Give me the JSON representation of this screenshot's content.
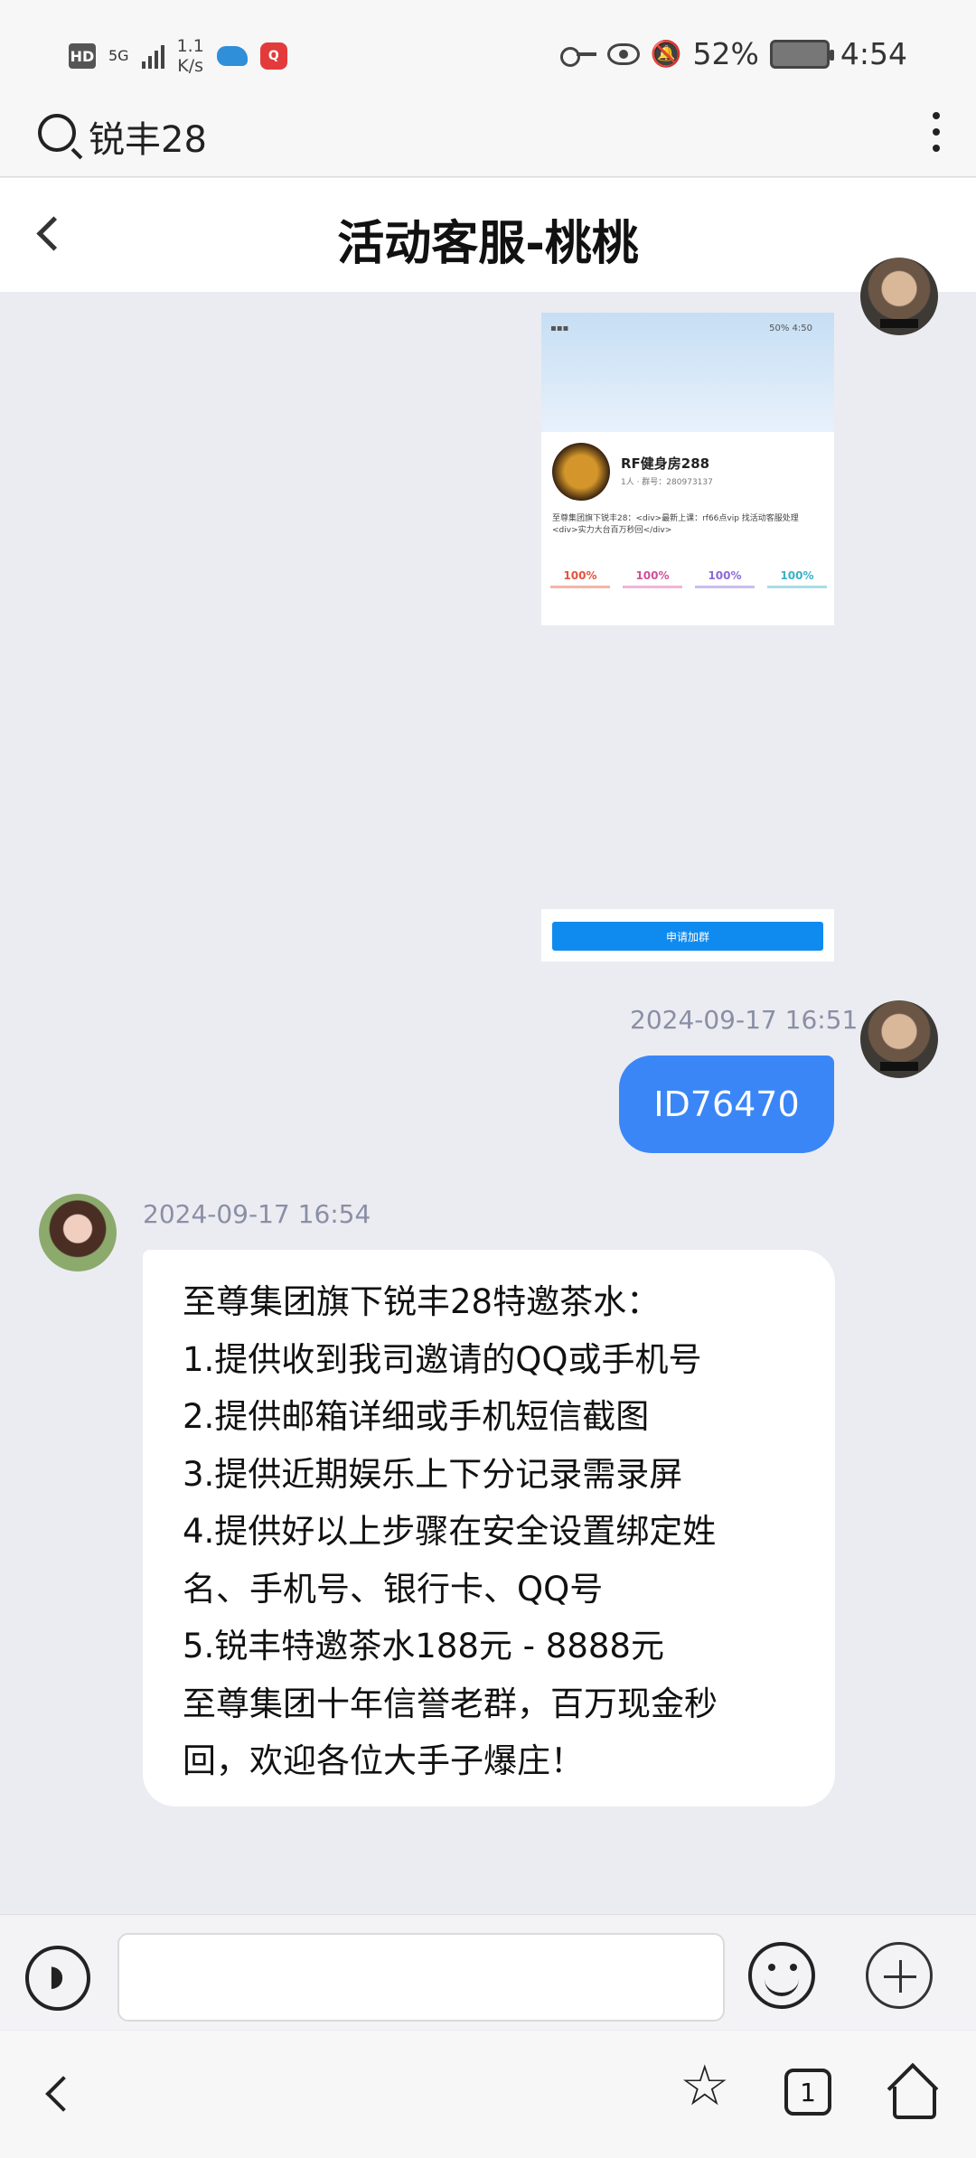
{
  "status_bar": {
    "network": "5G",
    "speed": "1.1\nK/s",
    "battery": "52%",
    "time": "4:54"
  },
  "search": {
    "query": "锐丰28"
  },
  "header": {
    "title": "活动客服-桃桃"
  },
  "messages": {
    "screenshot": {
      "mini_status": "50%  4:50",
      "group_name": "RF健身房288",
      "group_sub": "1人 · 群号：280973137",
      "description": "至尊集团旗下锐丰28：<div>最新上课：rf66点vip 找活动客服处理<div>实力大台百万秒回</div>",
      "stats": [
        "100%",
        "100%",
        "100%",
        "100%"
      ],
      "button": "申请加群"
    },
    "me_timestamp": "2024-09-17 16:51",
    "me_text": "ID76470",
    "her_timestamp": "2024-09-17 16:54",
    "her_lines": [
      "至尊集团旗下锐丰28特邀茶水：",
      "1.提供收到我司邀请的QQ或手机号",
      "2.提供邮箱详细或手机短信截图",
      "3.提供近期娱乐上下分记录需录屏",
      "4.提供好以上步骤在安全设置绑定姓",
      "名、手机号、银行卡、QQ号",
      "5.锐丰特邀茶水188元 - 8888元",
      "至尊集团十年信誉老群，百万现金秒",
      "回，欢迎各位大手子爆庄！"
    ]
  },
  "nav": {
    "tab_count": "1"
  }
}
